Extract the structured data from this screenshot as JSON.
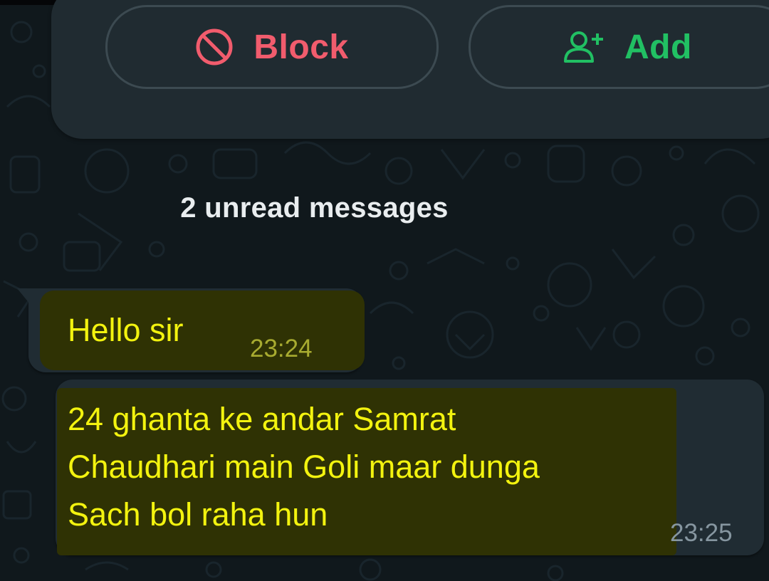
{
  "colors": {
    "danger": "#f15c6d",
    "accent": "#21c063",
    "message_highlight_text": "#f3f30f"
  },
  "contact_actions": {
    "block": {
      "label": "Block",
      "icon": "block-icon"
    },
    "add": {
      "label": "Add",
      "icon": "add-contact-icon"
    }
  },
  "unread_divider": {
    "label": "2 unread messages"
  },
  "messages": [
    {
      "lines": [
        "Hello sir"
      ],
      "time": "23:24"
    },
    {
      "lines": [
        "24 ghanta ke andar Samrat",
        "Chaudhari main Goli maar dunga",
        "Sach bol raha hun"
      ],
      "time": "23:25"
    }
  ]
}
